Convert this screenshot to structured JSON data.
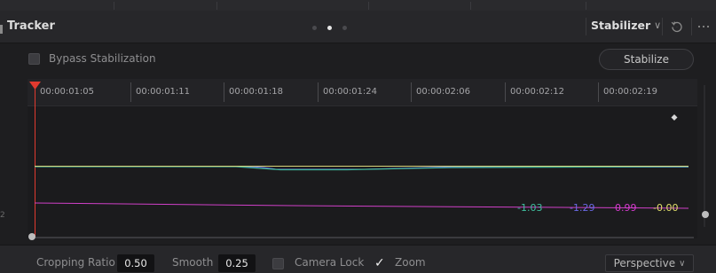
{
  "header": {
    "title": "Tracker",
    "mode": "Stabilizer",
    "page_dots": 3,
    "active_dot": 1
  },
  "controls": {
    "bypass_label": "Bypass Stabilization",
    "bypass_checked": false,
    "stabilize_label": "Stabilize"
  },
  "timeline": {
    "ticks": [
      "00:00:01:05",
      "00:00:01:11",
      "00:00:01:18",
      "00:00:01:24",
      "00:00:02:06",
      "00:00:02:12",
      "00:00:02:19"
    ]
  },
  "graph": {
    "values": [
      {
        "text": "-1.03",
        "color": "#3fbf9f"
      },
      {
        "text": "-1.29",
        "color": "#6a6ae6"
      },
      {
        "text": "0.99",
        "color": "#d83bd0"
      },
      {
        "text": "-0.00",
        "color": "#e2df6a"
      }
    ],
    "curve_colors": {
      "yellow": "#d8d47a",
      "teal": "#3fb59a",
      "blue": "#6a6ae6",
      "magenta": "#d040c8",
      "playhead": "#e03a2f"
    }
  },
  "bottom": {
    "cropping_label": "Cropping Ratio",
    "cropping_value": "0.50",
    "smooth_label": "Smooth",
    "smooth_value": "0.25",
    "camera_lock_label": "Camera Lock",
    "camera_lock_checked": false,
    "zoom_label": "Zoom",
    "zoom_checked": true,
    "transform_mode": "Perspective"
  }
}
